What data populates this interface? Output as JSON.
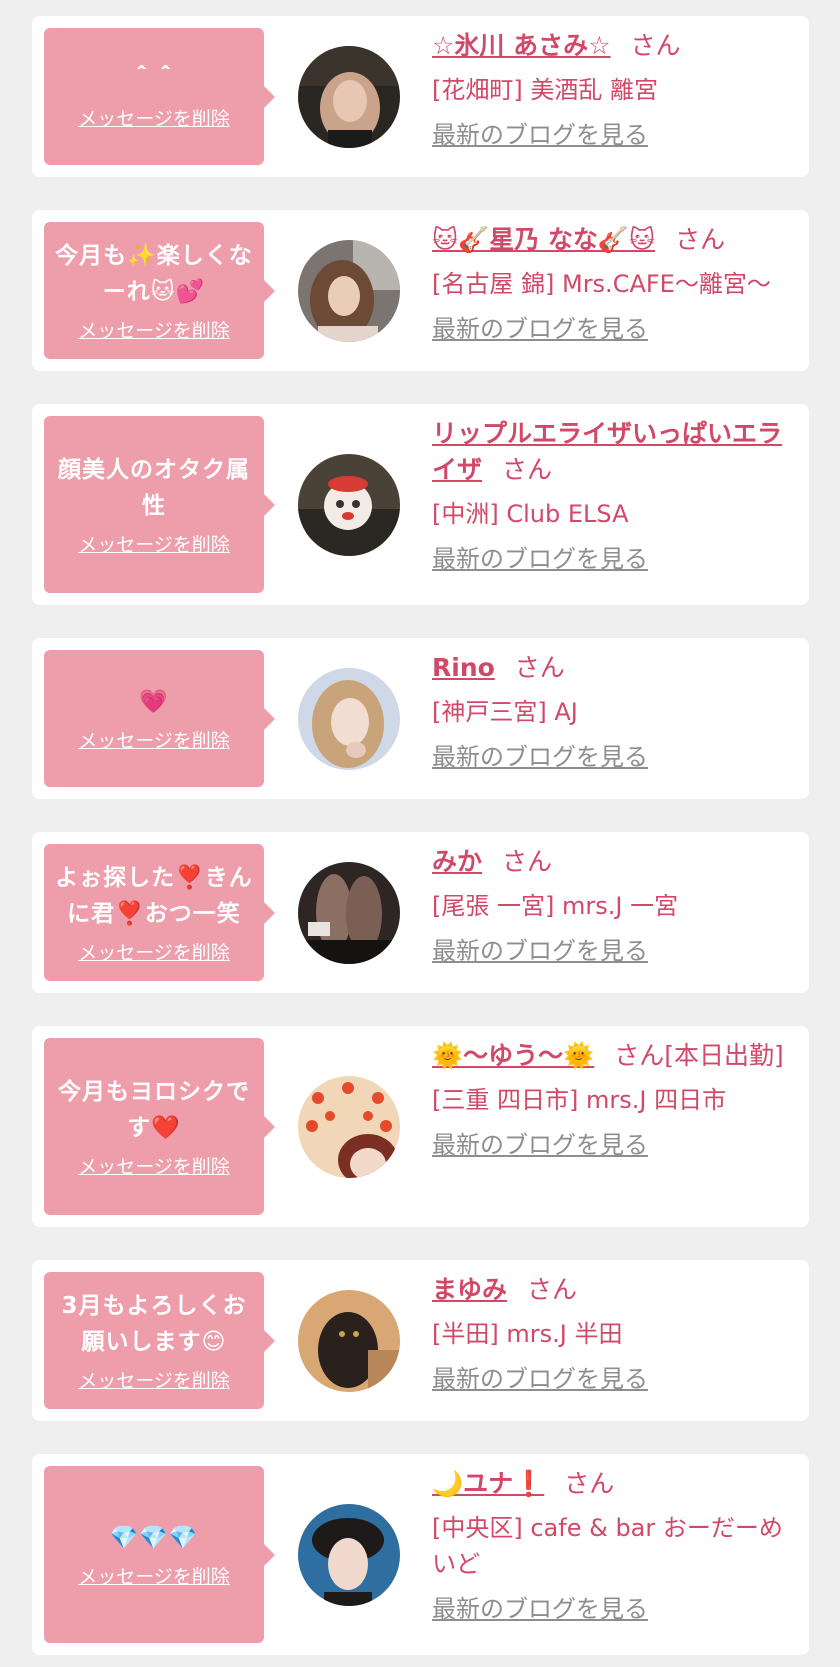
{
  "labels": {
    "delete": "メッセージを削除",
    "blog": "最新のブログを見る",
    "san": "さん"
  },
  "entries": [
    {
      "message": "＾＾",
      "name": "☆氷川 あさみ☆",
      "suffix": "さん",
      "shop": "[花畑町] 美酒乱 離宮",
      "avatar_icon": "profile-photo-asami"
    },
    {
      "message": "今月も✨楽しくなーれ🐱💕",
      "name": "🐱🎸星乃 なな🎸🐱",
      "suffix": "さん",
      "shop": "[名古屋 錦] Mrs.CAFE〜離宮〜",
      "avatar_icon": "profile-photo-nana"
    },
    {
      "message": "顔美人のオタク属性",
      "name": "リップルエライザいっぱいエライザ",
      "suffix": "さん",
      "shop": "[中洲] Club ELSA",
      "avatar_icon": "profile-photo-elsa"
    },
    {
      "message": "💗",
      "name": "Rino",
      "suffix": "さん",
      "shop": "[神戸三宮] AJ",
      "avatar_icon": "profile-photo-rino"
    },
    {
      "message": "よぉ探した❣️きんに君❣️おつ一笑",
      "name": "みか",
      "suffix": "さん",
      "shop": "[尾張 一宮] mrs.J 一宮",
      "avatar_icon": "profile-photo-mika"
    },
    {
      "message": "今月もヨロシクです❤️",
      "name": "🌞〜ゆう〜🌞",
      "suffix": "さん[本日出勤]",
      "shop": "[三重 四日市] mrs.J 四日市",
      "avatar_icon": "profile-photo-yuu"
    },
    {
      "message": "3月もよろしくお願いします😊",
      "name": "まゆみ",
      "suffix": "さん",
      "shop": "[半田] mrs.J 半田",
      "avatar_icon": "profile-photo-mayumi"
    },
    {
      "message": "💎💎💎",
      "name": "🌙ユナ❗️",
      "suffix": "さん",
      "shop": "[中央区] cafe & bar おーだーめいど",
      "avatar_icon": "profile-photo-yuna"
    }
  ],
  "colors": {
    "background": "#efefef",
    "card": "#ffffff",
    "bubble": "#ee9dab",
    "accent": "#d14868",
    "blog_link": "#8e8e8e"
  }
}
